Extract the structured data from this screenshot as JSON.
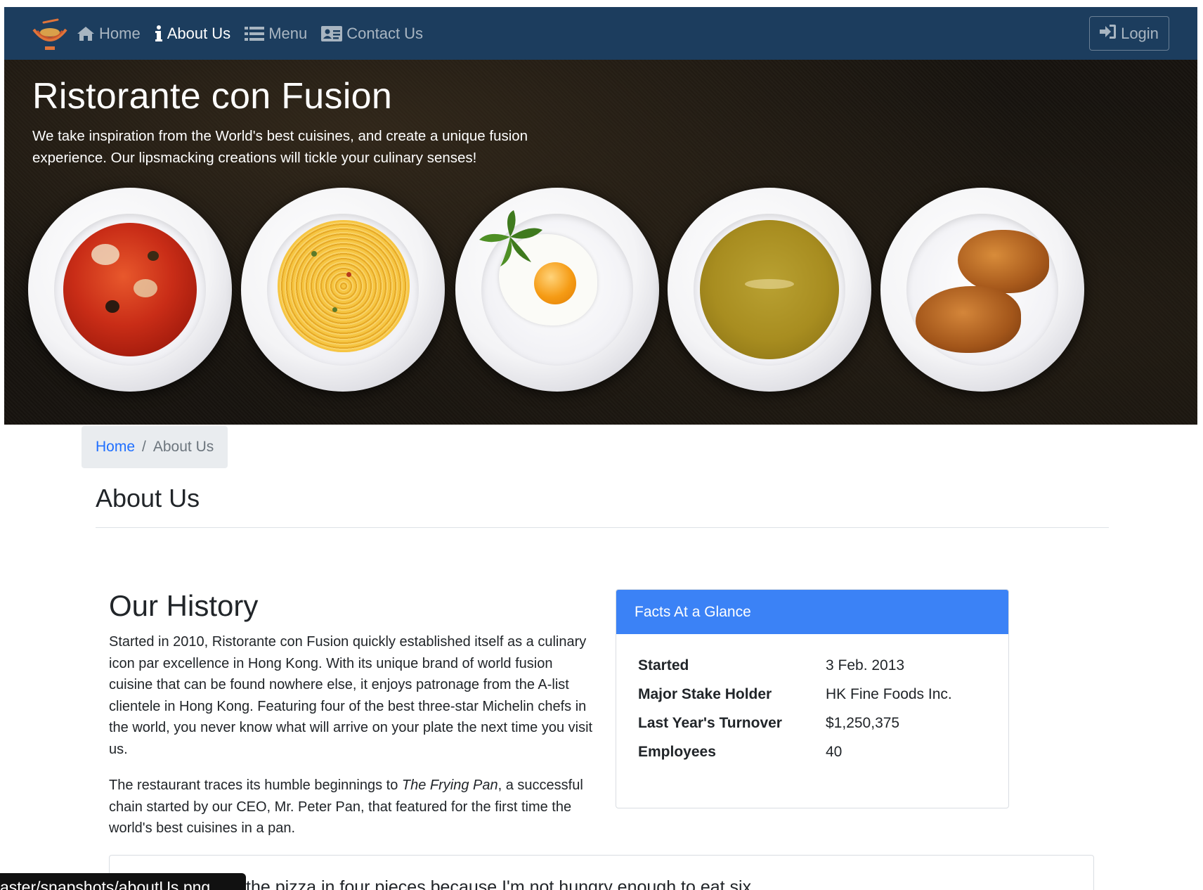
{
  "navbar": {
    "logo_icon": "restaurant-logo-icon",
    "items": [
      {
        "label": "Home",
        "icon": "home-icon",
        "active": false
      },
      {
        "label": "About Us",
        "icon": "info-icon",
        "active": true
      },
      {
        "label": "Menu",
        "icon": "list-icon",
        "active": false
      },
      {
        "label": "Contact Us",
        "icon": "address-card-icon",
        "active": false
      }
    ],
    "login_label": "Login",
    "background_color": "#1c3d5e"
  },
  "jumbotron": {
    "title": "Ristorante con Fusion",
    "text": "We take inspiration from the World's best cuisines, and create a unique fusion experience. Our lipsmacking creations will tickle your culinary senses!",
    "plates": [
      "tomato-soup",
      "spaghetti",
      "fried-egg",
      "pumpkin-soup",
      "croissants"
    ]
  },
  "breadcrumb": {
    "home_label": "Home",
    "separator": "/",
    "current_label": "About Us"
  },
  "page_title": "About Us",
  "history": {
    "title": "Our History",
    "paragraph1": "Started in 2010, Ristorante con Fusion quickly established itself as a culinary icon par excellence in Hong Kong. With its unique brand of world fusion cuisine that can be found nowhere else, it enjoys patronage from the A-list clientele in Hong Kong. Featuring four of the best three-star Michelin chefs in the world, you never know what will arrive on your plate the next time you visit us.",
    "paragraph2_before": "The restaurant traces its humble beginnings to ",
    "paragraph2_italic": "The Frying Pan",
    "paragraph2_after": ", a successful chain started by our CEO, Mr. Peter Pan, that featured for the first time the world's best cuisines in a pan."
  },
  "facts": {
    "header": "Facts At a Glance",
    "header_color": "#3b82f6",
    "rows": [
      {
        "label": "Started",
        "value": "3 Feb. 2013"
      },
      {
        "label": "Major Stake Holder",
        "value": "HK Fine Foods Inc."
      },
      {
        "label": "Last Year's Turnover",
        "value": "$1,250,375"
      },
      {
        "label": "Employees",
        "value": "40"
      }
    ]
  },
  "quote": {
    "text": "the pizza in four pieces because I'm not hungry enough to eat six."
  },
  "status_tooltip": "aster/snapshots/aboutUs.png"
}
